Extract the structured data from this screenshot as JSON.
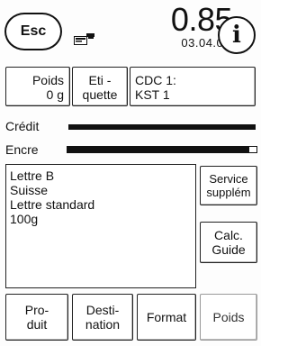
{
  "header": {
    "esc_label": "Esc",
    "amount": "0.85",
    "date": "03.04.09",
    "info_label": "i"
  },
  "tiles": {
    "poids_title": "Poids",
    "poids_value": "0 g",
    "etiquette_line1": "Eti -",
    "etiquette_line2": "quette",
    "cdc_line1": "CDC 1:",
    "cdc_line2": "KST 1"
  },
  "levels": {
    "credit_label": "Crédit",
    "credit_fill": 1.0,
    "encre_label": "Encre",
    "encre_fill": 0.96
  },
  "mail_info": {
    "lines": [
      "Lettre B",
      "Suisse",
      "Lettre standard",
      "100g"
    ]
  },
  "side_buttons": {
    "service_line1": "Service",
    "service_line2": "supplém",
    "calc_line1": "Calc.",
    "calc_line2": "Guide"
  },
  "bottom_tabs": {
    "produit_line1": "Pro-",
    "produit_line2": "duit",
    "destination_line1": "Desti-",
    "destination_line2": "nation",
    "format": "Format",
    "poids": "Poids"
  },
  "icons": {
    "meter": "postage-meter-icon"
  }
}
